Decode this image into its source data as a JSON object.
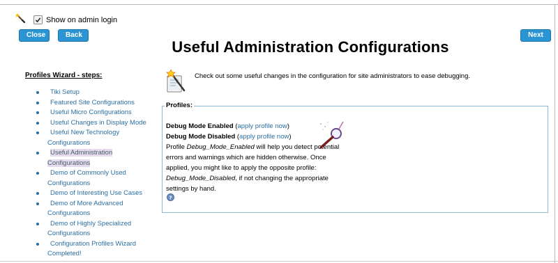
{
  "topbar": {
    "show_on_login_label": "Show on admin login",
    "show_on_login_checked": true
  },
  "buttons": {
    "close": "Close",
    "back": "Back",
    "next": "Next"
  },
  "page_title": "Useful Administration Configurations",
  "sidebar": {
    "heading": "Profiles Wizard - steps:",
    "steps": [
      {
        "label": "Tiki Setup"
      },
      {
        "label": "Featured Site Configurations"
      },
      {
        "label": "Useful Micro Configurations"
      },
      {
        "label": "Useful Changes in Display Mode"
      },
      {
        "label": "Useful New Technology Configurations"
      },
      {
        "label": "Useful Administration Configurations",
        "active": true
      },
      {
        "label": "Demo of Commonly Used Configurations"
      },
      {
        "label": "Demo of Interesting Use Cases"
      },
      {
        "label": "Demo of More Advanced Configurations"
      },
      {
        "label": "Demo of Highly Specialized Configurations"
      },
      {
        "label": "Configuration Profiles Wizard Completed!"
      }
    ]
  },
  "intro": {
    "text": "Check out some useful changes in the configuration for site administrators to ease debugging."
  },
  "profiles": {
    "legend": "Profiles:",
    "debug_enabled_name": "Debug Mode Enabled",
    "debug_disabled_name": "Debug Mode Disabled",
    "apply_link": "apply profile now",
    "para_part1": "Profile ",
    "para_em1": "Debug_Mode_Enabled",
    "para_part2": " will help you detect potential errors and warnings which are hidden otherwise. Once applied, you might like to apply the opposite profile: ",
    "para_em2": "Debug_Mode_Disabled",
    "para_part3": ", if not changing the appropriate settings by hand."
  },
  "colors": {
    "button_bg": "#2b95d3",
    "link": "#2a6fa3",
    "box_border": "#8fb8d2"
  }
}
